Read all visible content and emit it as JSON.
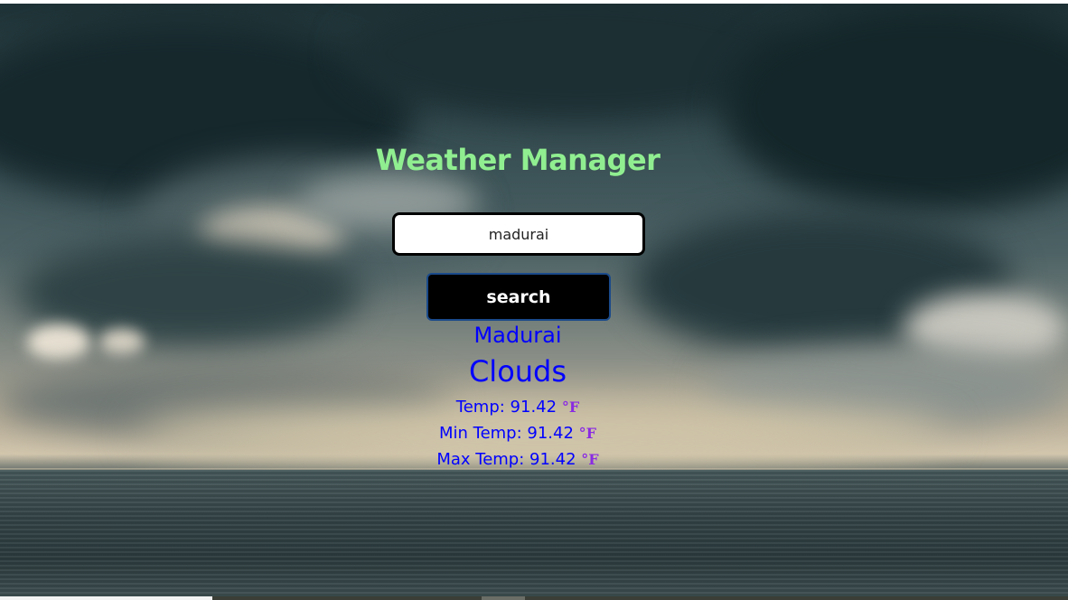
{
  "app": {
    "title": "Weather Manager"
  },
  "search": {
    "value": "madurai",
    "button_label": "search"
  },
  "result": {
    "city": "Madurai",
    "condition": "Clouds",
    "temp_label": "Temp: 91.42",
    "min_temp_label": "Min Temp: 91.42",
    "max_temp_label": "Max Temp: 91.42",
    "unit": "°F"
  },
  "colors": {
    "title": "#90ee90",
    "result_text": "#0000ff",
    "unit": "#8a2be2",
    "button_bg": "#000000",
    "button_text": "#ffffff"
  }
}
